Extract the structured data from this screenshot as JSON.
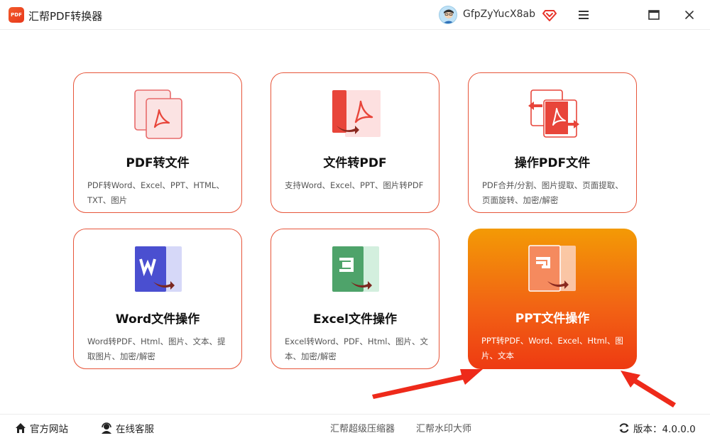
{
  "app": {
    "title": "汇帮PDF转换器",
    "logo_text": "PDF",
    "username": "GfpZyYucX8ab"
  },
  "cards": [
    {
      "title": "PDF转文件",
      "desc": "PDF转Word、Excel、PPT、HTML、TXT、图片",
      "icon": "pdf-convert-icon"
    },
    {
      "title": "文件转PDF",
      "desc": "支持Word、Excel、PPT、图片转PDF",
      "icon": "file-to-pdf-icon"
    },
    {
      "title": "操作PDF文件",
      "desc": "PDF合并/分割、图片提取、页面提取、页面旋转、加密/解密",
      "icon": "pdf-operate-icon"
    },
    {
      "title": "Word文件操作",
      "desc": "Word转PDF、Html、图片、文本、提取图片、加密/解密",
      "icon": "word-icon"
    },
    {
      "title": "Excel文件操作",
      "desc": "Excel转Word、PDF、Html、图片、文本、加密/解密",
      "icon": "excel-icon"
    },
    {
      "title": "PPT文件操作",
      "desc": "PPT转PDF、Word、Excel、Html、图片、文本",
      "icon": "ppt-icon",
      "active": true
    }
  ],
  "footer": {
    "website": "官方网站",
    "support": "在线客服",
    "compressor": "汇帮超级压缩器",
    "watermark": "汇帮水印大师",
    "version": "版本：4.0.0.0"
  },
  "colors": {
    "accent": "#e7553a",
    "active_top": "#f39a05",
    "active_bottom": "#ee3a12",
    "annotation_arrow": "#ee2a1a"
  }
}
